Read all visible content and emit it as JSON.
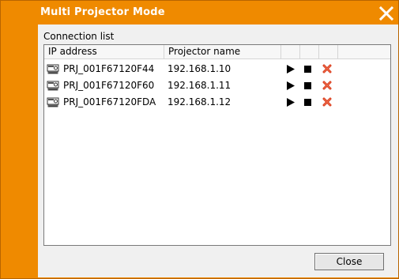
{
  "window": {
    "title": "Multi Projector Mode",
    "close_icon": "close-icon",
    "accent_color": "#ef8a00"
  },
  "connection": {
    "group_label": "Connection list",
    "columns": [
      "IP address",
      "Projector name",
      "",
      "",
      ""
    ],
    "rows": [
      {
        "name": "PRJ_001F67120F44",
        "ip": "192.168.1.10",
        "icon": "projector-icon"
      },
      {
        "name": "PRJ_001F67120F60",
        "ip": "192.168.1.11",
        "icon": "projector-icon"
      },
      {
        "name": "PRJ_001F67120FDA",
        "ip": "192.168.1.12",
        "icon": "projector-icon"
      }
    ],
    "row_actions": [
      "play-icon",
      "stop-icon",
      "delete-icon"
    ]
  },
  "footer": {
    "close_label": "Close"
  }
}
